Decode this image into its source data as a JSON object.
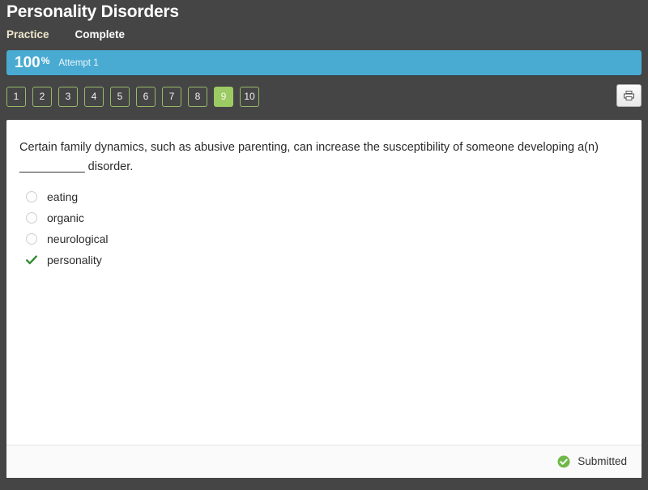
{
  "header": {
    "title": "Personality Disorders",
    "tabs": [
      {
        "label": "Practice",
        "active": true
      },
      {
        "label": "Complete",
        "active": false
      }
    ]
  },
  "progress": {
    "score": "100",
    "percent_symbol": "%",
    "attempt_label": "Attempt 1",
    "fill_percent": 100,
    "bar_color": "#4aabd2"
  },
  "question_nav": {
    "buttons": [
      {
        "label": "1",
        "current": false
      },
      {
        "label": "2",
        "current": false
      },
      {
        "label": "3",
        "current": false
      },
      {
        "label": "4",
        "current": false
      },
      {
        "label": "5",
        "current": false
      },
      {
        "label": "6",
        "current": false
      },
      {
        "label": "7",
        "current": false
      },
      {
        "label": "8",
        "current": false
      },
      {
        "label": "9",
        "current": true
      },
      {
        "label": "10",
        "current": false
      }
    ],
    "current_color": "#9ccb63",
    "border_color": "#96b96a",
    "print_icon": "printer-icon"
  },
  "question": {
    "text": "Certain family dynamics, such as abusive parenting, can increase the susceptibility of someone developing a(n) __________ disorder.",
    "answers": [
      {
        "label": "eating",
        "state": "unselected",
        "icon": "radio-unchecked-icon"
      },
      {
        "label": "organic",
        "state": "unselected",
        "icon": "radio-unchecked-icon"
      },
      {
        "label": "neurological",
        "state": "unselected",
        "icon": "radio-unchecked-icon"
      },
      {
        "label": "personality",
        "state": "correct",
        "icon": "check-icon"
      }
    ]
  },
  "footer": {
    "status_label": "Submitted",
    "status_icon": "check-circle-icon",
    "status_color": "#70b84a"
  }
}
